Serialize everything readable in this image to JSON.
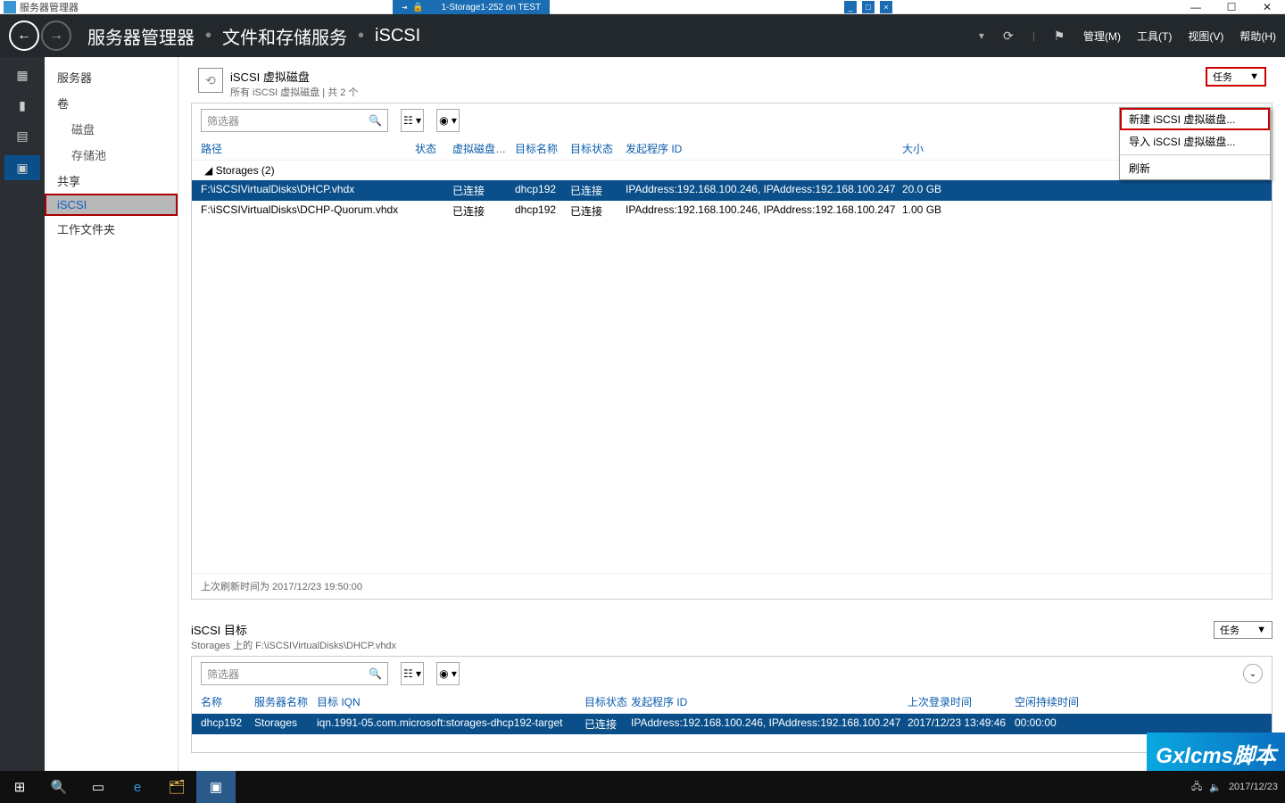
{
  "outer": {
    "app_title": "服务器管理器",
    "vm_title": "1-Storage1-252 on TEST"
  },
  "header": {
    "crumb1": "服务器管理器",
    "crumb2": "文件和存储服务",
    "crumb3": "iSCSI",
    "menu_manage": "管理(M)",
    "menu_tools": "工具(T)",
    "menu_view": "视图(V)",
    "menu_help": "帮助(H)"
  },
  "sidebar": {
    "items": [
      "服务器",
      "卷",
      "磁盘",
      "存储池",
      "共享",
      "iSCSI",
      "工作文件夹"
    ],
    "selected_index": 5
  },
  "panel1": {
    "title": "iSCSI 虚拟磁盘",
    "subtitle": "所有 iSCSI 虚拟磁盘 | 共 2 个",
    "tasks_label": "任务",
    "filter_placeholder": "筛选器",
    "columns": {
      "path": "路径",
      "status": "状态",
      "disk_status": "虚拟磁盘状态",
      "target_name": "目标名称",
      "target_status": "目标状态",
      "initiator": "发起程序 ID",
      "size": "大小"
    },
    "group_label": "Storages (2)",
    "rows": [
      {
        "path": "F:\\iSCSIVirtualDisks\\DHCP.vhdx",
        "status": "",
        "disk_status": "已连接",
        "target_name": "dhcp192",
        "target_status": "已连接",
        "initiator": "IPAddress:192.168.100.246, IPAddress:192.168.100.247",
        "size": "20.0 GB"
      },
      {
        "path": "F:\\iSCSIVirtualDisks\\DCHP-Quorum.vhdx",
        "status": "",
        "disk_status": "已连接",
        "target_name": "dhcp192",
        "target_status": "已连接",
        "initiator": "IPAddress:192.168.100.246, IPAddress:192.168.100.247",
        "size": "1.00 GB"
      }
    ],
    "footnote": "上次刷新时间为 2017/12/23 19:50:00"
  },
  "dropdown": {
    "new_disk": "新建 iSCSI 虚拟磁盘...",
    "import_disk": "导入 iSCSI 虚拟磁盘...",
    "refresh": "刷新"
  },
  "panel2": {
    "title": "iSCSI 目标",
    "subtitle": "Storages 上的 F:\\iSCSIVirtualDisks\\DHCP.vhdx",
    "tasks_label": "任务",
    "filter_placeholder": "筛选器",
    "columns": {
      "name": "名称",
      "server": "服务器名称",
      "iqn": "目标 IQN",
      "target_status": "目标状态",
      "initiator": "发起程序 ID",
      "last_login": "上次登录时间",
      "idle": "空闲持续时间"
    },
    "rows": [
      {
        "name": "dhcp192",
        "server": "Storages",
        "iqn": "iqn.1991-05.com.microsoft:storages-dhcp192-target",
        "target_status": "已连接",
        "initiator": "IPAddress:192.168.100.246, IPAddress:192.168.100.247",
        "last_login": "2017/12/23 13:49:46",
        "idle": "00:00:00"
      }
    ]
  },
  "watermark": "Gxlcms脚本",
  "taskbar": {
    "date": "2017/12/23"
  }
}
